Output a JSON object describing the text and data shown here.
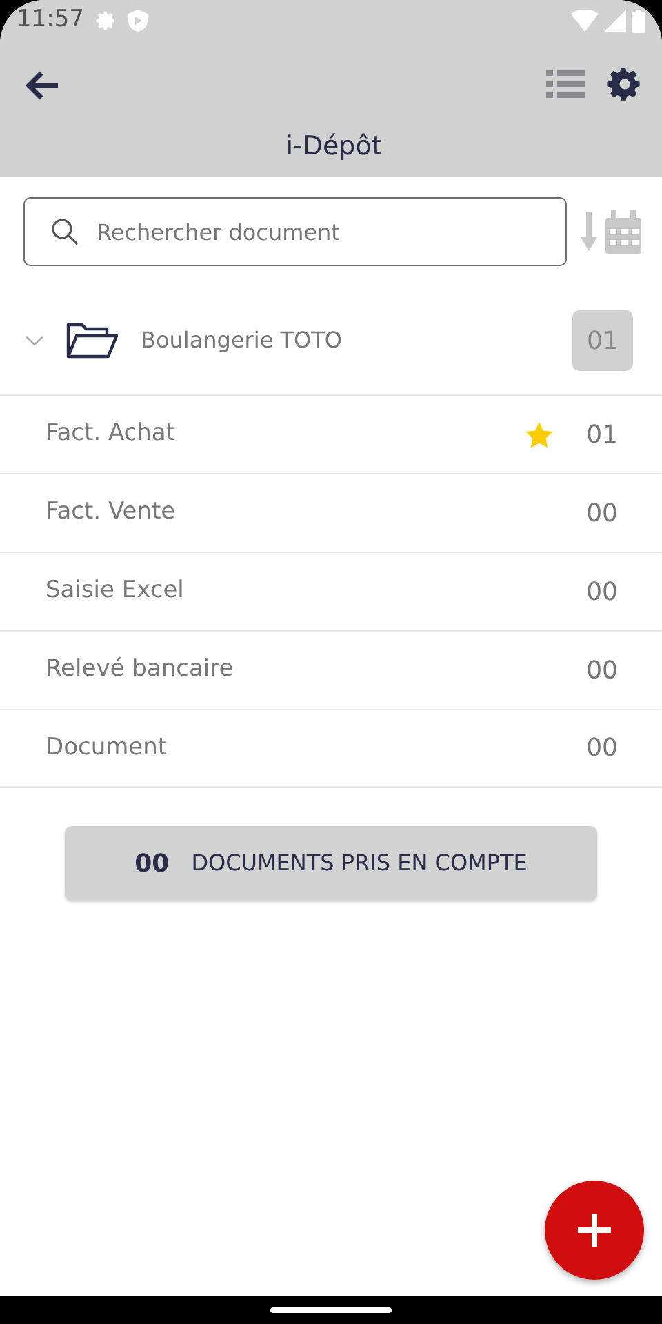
{
  "status_bar": {
    "time": "11:57"
  },
  "app_bar": {
    "title": "i-Dépôt"
  },
  "search": {
    "placeholder": "Rechercher document"
  },
  "folder": {
    "name": "Boulangerie TOTO",
    "count": "01",
    "expanded": true
  },
  "categories": [
    {
      "name": "Fact. Achat",
      "count": "01",
      "starred": true
    },
    {
      "name": "Fact. Vente",
      "count": "00",
      "starred": false
    },
    {
      "name": "Saisie Excel",
      "count": "00",
      "starred": false
    },
    {
      "name": "Relevé bancaire",
      "count": "00",
      "starred": false
    },
    {
      "name": "Document",
      "count": "00",
      "starred": false
    }
  ],
  "summary": {
    "count": "00",
    "label": "DOCUMENTS PRIS EN COMPTE"
  }
}
